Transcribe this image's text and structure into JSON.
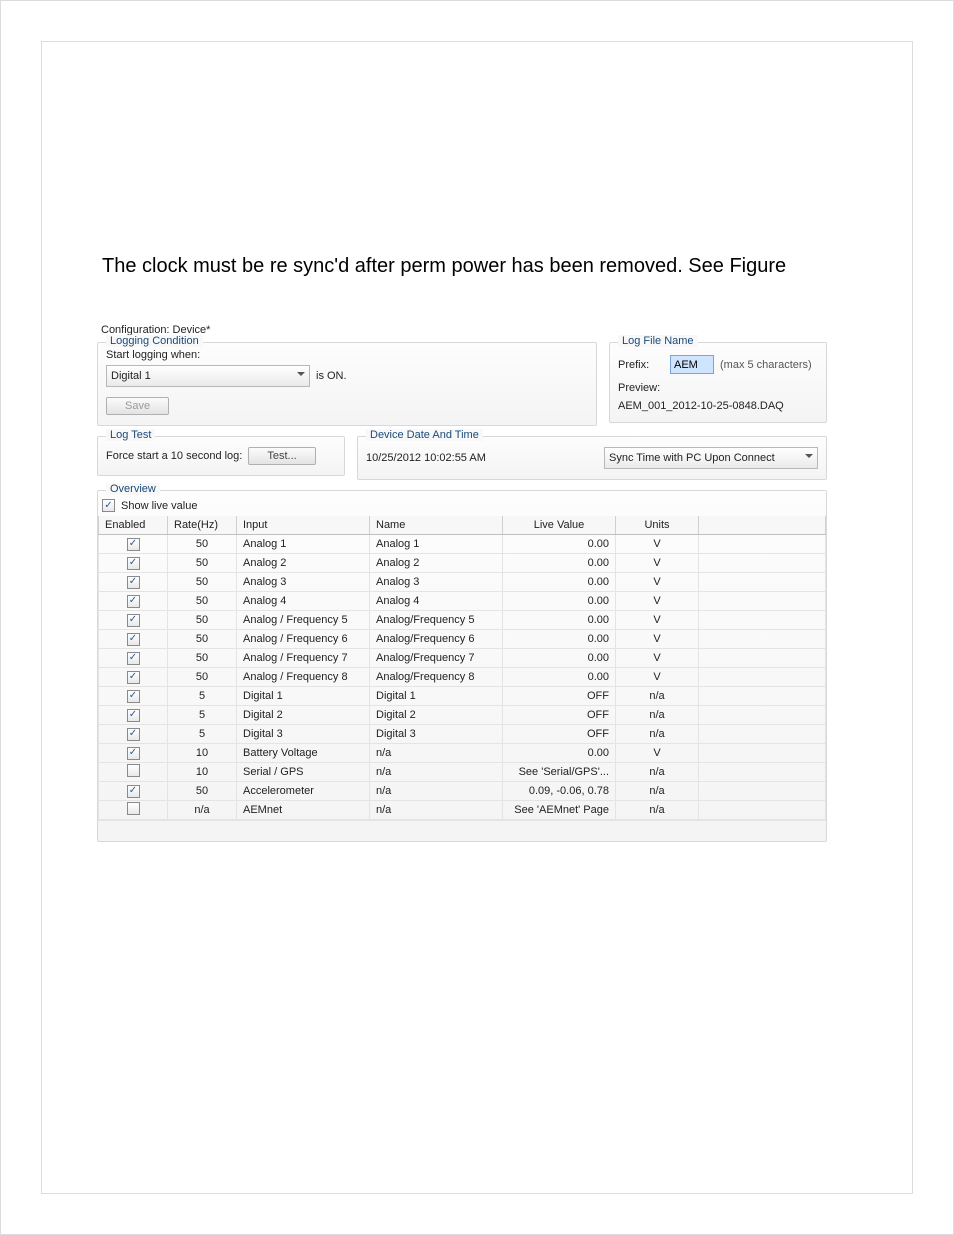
{
  "caption": "The clock must be re sync'd after perm power has been removed.  See Figure",
  "window_title": "Configuration: Device*",
  "logging": {
    "legend": "Logging Condition",
    "start_label": "Start logging when:",
    "channel": "Digital 1",
    "state_suffix": "is ON.",
    "save_label": "Save"
  },
  "logfile": {
    "legend": "Log File Name",
    "prefix_label": "Prefix:",
    "prefix_value": "AEM",
    "prefix_hint": "(max 5 characters)",
    "preview_label": "Preview:",
    "preview_value": "AEM_001_2012-10-25-0848.DAQ"
  },
  "logtest": {
    "legend": "Log Test",
    "label": "Force start a 10 second log:",
    "button": "Test..."
  },
  "datetime": {
    "legend": "Device Date And Time",
    "value": "10/25/2012 10:02:55 AM",
    "sync_option": "Sync Time with PC Upon Connect"
  },
  "overview": {
    "legend": "Overview",
    "show_live_label": "Show live value",
    "columns": {
      "enabled": "Enabled",
      "rate": "Rate(Hz)",
      "input": "Input",
      "name": "Name",
      "live": "Live Value",
      "units": "Units"
    },
    "rows": [
      {
        "enabled": true,
        "rate": "50",
        "input": "Analog 1",
        "name": "Analog 1",
        "live": "0.00",
        "units": "V"
      },
      {
        "enabled": true,
        "rate": "50",
        "input": "Analog 2",
        "name": "Analog 2",
        "live": "0.00",
        "units": "V"
      },
      {
        "enabled": true,
        "rate": "50",
        "input": "Analog 3",
        "name": "Analog 3",
        "live": "0.00",
        "units": "V"
      },
      {
        "enabled": true,
        "rate": "50",
        "input": "Analog 4",
        "name": "Analog 4",
        "live": "0.00",
        "units": "V"
      },
      {
        "enabled": true,
        "rate": "50",
        "input": "Analog / Frequency 5",
        "name": "Analog/Frequency 5",
        "live": "0.00",
        "units": "V"
      },
      {
        "enabled": true,
        "rate": "50",
        "input": "Analog / Frequency 6",
        "name": "Analog/Frequency 6",
        "live": "0.00",
        "units": "V"
      },
      {
        "enabled": true,
        "rate": "50",
        "input": "Analog / Frequency 7",
        "name": "Analog/Frequency 7",
        "live": "0.00",
        "units": "V"
      },
      {
        "enabled": true,
        "rate": "50",
        "input": "Analog / Frequency 8",
        "name": "Analog/Frequency 8",
        "live": "0.00",
        "units": "V"
      },
      {
        "enabled": true,
        "rate": "5",
        "input": "Digital 1",
        "name": "Digital 1",
        "live": "OFF",
        "units": "n/a"
      },
      {
        "enabled": true,
        "rate": "5",
        "input": "Digital 2",
        "name": "Digital 2",
        "live": "OFF",
        "units": "n/a"
      },
      {
        "enabled": true,
        "rate": "5",
        "input": "Digital 3",
        "name": "Digital 3",
        "live": "OFF",
        "units": "n/a"
      },
      {
        "enabled": true,
        "rate": "10",
        "input": "Battery Voltage",
        "name": "n/a",
        "live": "0.00",
        "units": "V"
      },
      {
        "enabled": false,
        "rate": "10",
        "input": "Serial / GPS",
        "name": "n/a",
        "live": "See 'Serial/GPS'...",
        "units": "n/a"
      },
      {
        "enabled": true,
        "rate": "50",
        "input": "Accelerometer",
        "name": "n/a",
        "live": "0.09, -0.06, 0.78",
        "units": "n/a"
      },
      {
        "enabled": false,
        "rate": "n/a",
        "input": "AEMnet",
        "name": "n/a",
        "live": "See 'AEMnet' Page",
        "units": "n/a"
      }
    ]
  }
}
